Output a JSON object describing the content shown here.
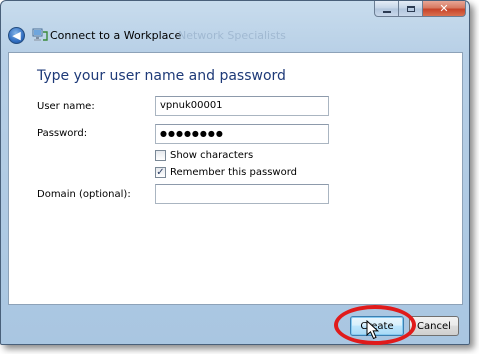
{
  "window": {
    "title": "Connect to a Workplace",
    "ghost_title": "Network Specialists",
    "caption": {
      "minimize_icon": "minimize-icon",
      "maximize_icon": "maximize-icon",
      "close_glyph": "✕"
    },
    "back_glyph": "◀"
  },
  "form": {
    "heading": "Type your user name and password",
    "username_label": "User name:",
    "username_value": "vpnuk00001",
    "password_label": "Password:",
    "password_value": "●●●●●●●●",
    "show_characters_label": "Show characters",
    "show_characters_checked": false,
    "remember_password_label": "Remember this password",
    "remember_password_checked": true,
    "remember_check_glyph": "✓",
    "domain_label": "Domain (optional):",
    "domain_value": ""
  },
  "buttons": {
    "create_label": "Create",
    "cancel_label": "Cancel"
  },
  "annotation": {
    "highlight_color": "#e01b1b"
  }
}
